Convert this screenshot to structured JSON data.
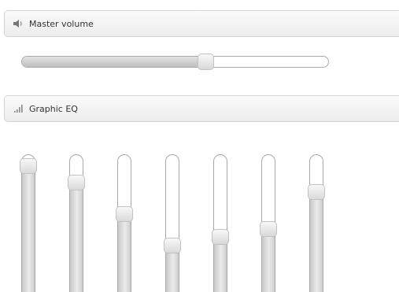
{
  "master_volume": {
    "title": "Master volume",
    "icon": "speaker-icon",
    "value_fraction": 0.6
  },
  "graphic_eq": {
    "title": "Graphic EQ",
    "icon": "signal-bars-icon",
    "bands": [
      {
        "value_fraction": 0.92
      },
      {
        "value_fraction": 0.81
      },
      {
        "value_fraction": 0.6
      },
      {
        "value_fraction": 0.39
      },
      {
        "value_fraction": 0.45
      },
      {
        "value_fraction": 0.5
      },
      {
        "value_fraction": 0.75
      }
    ]
  }
}
